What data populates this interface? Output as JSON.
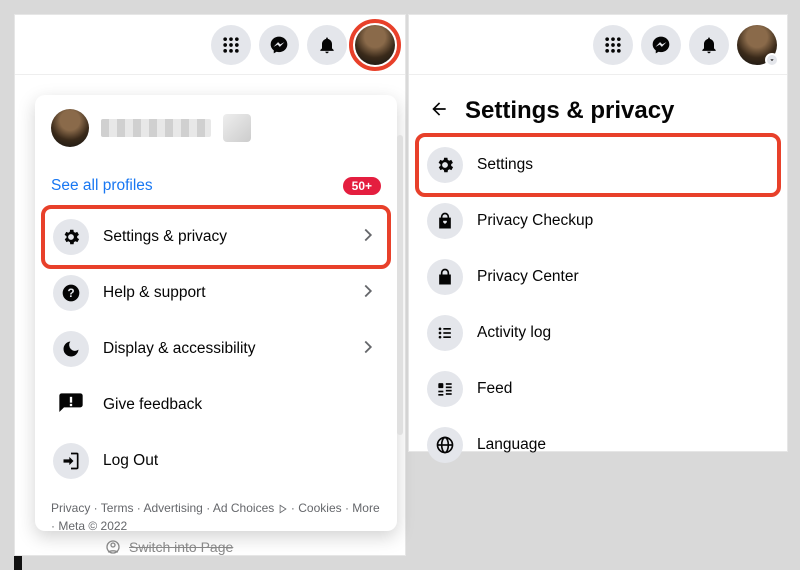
{
  "left": {
    "see_all_profiles": "See all profiles",
    "badge": "50+",
    "menu": {
      "settings_privacy": "Settings & privacy",
      "help_support": "Help & support",
      "display_access": "Display & accessibility",
      "give_feedback": "Give feedback",
      "log_out": "Log Out"
    },
    "footer": {
      "privacy": "Privacy",
      "terms": "Terms",
      "advertising": "Advertising",
      "ad_choices": "Ad Choices",
      "cookies": "Cookies",
      "more": "More",
      "meta": "Meta © 2022"
    },
    "switch_into_page": "Switch into Page"
  },
  "right": {
    "title": "Settings & privacy",
    "menu": {
      "settings": "Settings",
      "privacy_checkup": "Privacy Checkup",
      "privacy_center": "Privacy Center",
      "activity_log": "Activity log",
      "feed": "Feed",
      "language": "Language"
    }
  }
}
